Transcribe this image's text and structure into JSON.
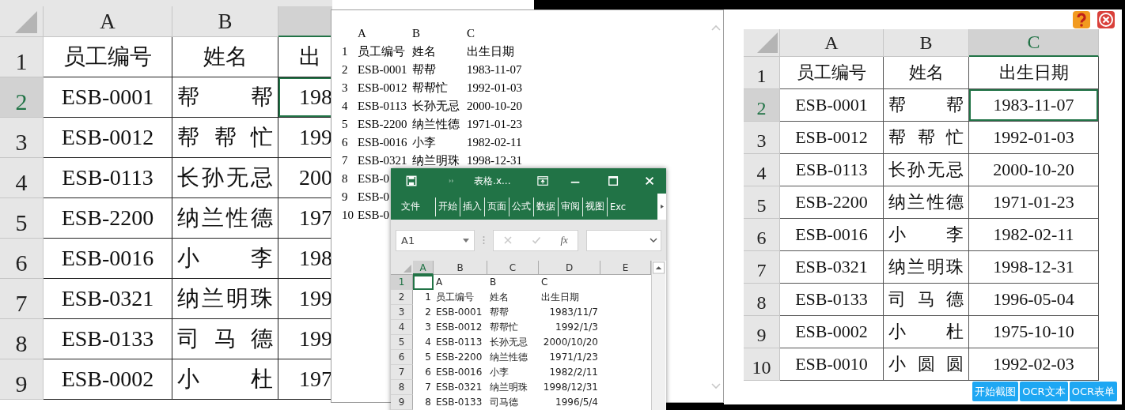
{
  "left_sheet": {
    "columns": [
      {
        "label": "A",
        "selected": false
      },
      {
        "label": "B",
        "selected": false
      },
      {
        "selected": true
      }
    ],
    "rows": [
      {
        "header": "1",
        "selected": false,
        "cells": [
          {
            "text": "员工编号",
            "selected": false
          },
          {
            "text": "姓名",
            "selected": false
          },
          {
            "text": "出",
            "selected": false
          }
        ]
      },
      {
        "header": "2",
        "selected": true,
        "cells": [
          {
            "text": "ESB-0001",
            "selected": false
          },
          {
            "text": "帮帮",
            "selected": false
          },
          {
            "text": "198",
            "selected": true
          }
        ]
      },
      {
        "header": "3",
        "selected": false,
        "cells": [
          {
            "text": "ESB-0012",
            "selected": false
          },
          {
            "text": "帮帮忙",
            "selected": false
          },
          {
            "text": "199",
            "selected": false
          }
        ]
      },
      {
        "header": "4",
        "selected": false,
        "cells": [
          {
            "text": "ESB-0113",
            "selected": false
          },
          {
            "text": "长孙无忌",
            "selected": false
          },
          {
            "text": "200",
            "selected": false
          }
        ]
      },
      {
        "header": "5",
        "selected": false,
        "cells": [
          {
            "text": "ESB-2200",
            "selected": false
          },
          {
            "text": "纳兰性德",
            "selected": false
          },
          {
            "text": "197",
            "selected": false
          }
        ]
      },
      {
        "header": "6",
        "selected": false,
        "cells": [
          {
            "text": "ESB-0016",
            "selected": false
          },
          {
            "text": "小李",
            "selected": false
          },
          {
            "text": "198",
            "selected": false
          }
        ]
      },
      {
        "header": "7",
        "selected": false,
        "cells": [
          {
            "text": "ESB-0321",
            "selected": false
          },
          {
            "text": "纳兰明珠",
            "selected": false
          },
          {
            "text": "199",
            "selected": false
          }
        ]
      },
      {
        "header": "8",
        "selected": false,
        "cells": [
          {
            "text": "ESB-0133",
            "selected": false
          },
          {
            "text": "司马德",
            "selected": false
          },
          {
            "text": "199",
            "selected": false
          }
        ]
      },
      {
        "header": "9",
        "selected": false,
        "cells": [
          {
            "text": "ESB-0002",
            "selected": false
          },
          {
            "text": "小杜",
            "selected": false
          },
          {
            "text": "197",
            "selected": false
          }
        ]
      }
    ]
  },
  "text_view": {
    "header": [
      "A",
      "B",
      "C"
    ],
    "lines": [
      {
        "number": "1",
        "fields": [
          "员工编号",
          "姓名",
          "出生日期"
        ]
      },
      {
        "number": "2",
        "fields": [
          "ESB-0001",
          "帮帮",
          "1983-11-07"
        ]
      },
      {
        "number": "3",
        "fields": [
          "ESB-0012",
          "帮帮忙",
          "1992-01-03"
        ]
      },
      {
        "number": "4",
        "fields": [
          "ESB-0113",
          "长孙无忌",
          "2000-10-20"
        ]
      },
      {
        "number": "5",
        "fields": [
          "ESB-2200",
          "纳兰性德",
          "1971-01-23"
        ]
      },
      {
        "number": "6",
        "fields": [
          "ESB-0016",
          "小李",
          "1982-02-11"
        ]
      },
      {
        "number": "7",
        "fields": [
          "ESB-0321",
          "纳兰明珠",
          "1998-12-31"
        ]
      },
      {
        "number": "8",
        "fields": [
          "ESB-0"
        ]
      },
      {
        "number": "9",
        "fields": [
          "ESB-0"
        ]
      },
      {
        "number": "10",
        "fields": [
          "ESB-0"
        ]
      }
    ]
  },
  "excel_window": {
    "title": "表格.x...",
    "tabs": [
      {
        "label": "文件",
        "selected": false
      },
      {
        "label": "开始",
        "selected": false
      },
      {
        "label": "插入",
        "selected": false
      },
      {
        "label": "页面",
        "selected": false
      },
      {
        "label": "公式",
        "selected": false
      },
      {
        "label": "数据",
        "selected": false
      },
      {
        "label": "审阅",
        "selected": false
      },
      {
        "label": "视图",
        "selected": false
      },
      {
        "label": "Exc",
        "selected": false
      }
    ],
    "name_box": "A1",
    "function_label": "fx",
    "columns": [
      {
        "label": "A",
        "selected": true
      },
      {
        "label": "B",
        "selected": false
      },
      {
        "label": "C",
        "selected": false
      },
      {
        "label": "D",
        "selected": false
      },
      {
        "label": "E",
        "selected": false
      }
    ],
    "rows": [
      {
        "header": "1",
        "selected": true,
        "cells": [
          {
            "selected": true
          },
          {
            "text": "A",
            "kind": "text",
            "selected": false
          },
          {
            "text": "B",
            "kind": "text",
            "selected": false
          },
          {
            "text": "C",
            "kind": "text",
            "selected": false
          }
        ]
      },
      {
        "header": "2",
        "selected": false,
        "cells": [
          {
            "text": "1",
            "kind": "number",
            "selected": false
          },
          {
            "text": "员工编号",
            "kind": "text",
            "selected": false
          },
          {
            "text": "姓名",
            "kind": "text",
            "selected": false
          },
          {
            "text": "出生日期",
            "kind": "text",
            "selected": false
          }
        ]
      },
      {
        "header": "3",
        "selected": false,
        "cells": [
          {
            "text": "2",
            "kind": "number",
            "selected": false
          },
          {
            "text": "ESB-0001",
            "kind": "text",
            "selected": false
          },
          {
            "text": "帮帮",
            "kind": "text",
            "selected": false
          },
          {
            "text": "1983/11/7",
            "kind": "number",
            "selected": false
          }
        ]
      },
      {
        "header": "4",
        "selected": false,
        "cells": [
          {
            "text": "3",
            "kind": "number",
            "selected": false
          },
          {
            "text": "ESB-0012",
            "kind": "text",
            "selected": false
          },
          {
            "text": "帮帮忙",
            "kind": "text",
            "selected": false
          },
          {
            "text": "1992/1/3",
            "kind": "number",
            "selected": false
          }
        ]
      },
      {
        "header": "5",
        "selected": false,
        "cells": [
          {
            "text": "4",
            "kind": "number",
            "selected": false
          },
          {
            "text": "ESB-0113",
            "kind": "text",
            "selected": false
          },
          {
            "text": "长孙无忌",
            "kind": "text",
            "selected": false
          },
          {
            "text": "2000/10/20",
            "kind": "number",
            "selected": false
          }
        ]
      },
      {
        "header": "6",
        "selected": false,
        "cells": [
          {
            "text": "5",
            "kind": "number",
            "selected": false
          },
          {
            "text": "ESB-2200",
            "kind": "text",
            "selected": false
          },
          {
            "text": "纳兰性德",
            "kind": "text",
            "selected": false
          },
          {
            "text": "1971/1/23",
            "kind": "number",
            "selected": false
          }
        ]
      },
      {
        "header": "7",
        "selected": false,
        "cells": [
          {
            "text": "6",
            "kind": "number",
            "selected": false
          },
          {
            "text": "ESB-0016",
            "kind": "text",
            "selected": false
          },
          {
            "text": "小李",
            "kind": "text",
            "selected": false
          },
          {
            "text": "1982/2/11",
            "kind": "number",
            "selected": false
          }
        ]
      },
      {
        "header": "8",
        "selected": false,
        "cells": [
          {
            "text": "7",
            "kind": "number",
            "selected": false
          },
          {
            "text": "ESB-0321",
            "kind": "text",
            "selected": false
          },
          {
            "text": "纳兰明珠",
            "kind": "text",
            "selected": false
          },
          {
            "text": "1998/12/31",
            "kind": "number",
            "selected": false
          }
        ]
      },
      {
        "header": "9",
        "selected": false,
        "cells": [
          {
            "text": "8",
            "kind": "number",
            "selected": false
          },
          {
            "text": "ESB-0133",
            "kind": "text",
            "selected": false
          },
          {
            "text": "司马德",
            "kind": "text",
            "selected": false
          },
          {
            "text": "1996/5/4",
            "kind": "number",
            "selected": false
          }
        ]
      }
    ]
  },
  "ocr_panel": {
    "sheet": {
      "columns": [
        {
          "label": "A",
          "selected": false
        },
        {
          "label": "B",
          "selected": false
        },
        {
          "label": "C",
          "selected": true
        }
      ],
      "rows": [
        {
          "header": "1",
          "selected": false,
          "cells": [
            {
              "text": "员工编号",
              "selected": false
            },
            {
              "text": "姓名",
              "selected": false
            },
            {
              "text": "出生日期",
              "selected": false
            }
          ]
        },
        {
          "header": "2",
          "selected": true,
          "cells": [
            {
              "text": "ESB-0001",
              "selected": false
            },
            {
              "text": "帮帮",
              "selected": false
            },
            {
              "text": "1983-11-07",
              "selected": true
            }
          ]
        },
        {
          "header": "3",
          "selected": false,
          "cells": [
            {
              "text": "ESB-0012",
              "selected": false
            },
            {
              "text": "帮帮忙",
              "selected": false
            },
            {
              "text": "1992-01-03",
              "selected": false
            }
          ]
        },
        {
          "header": "4",
          "selected": false,
          "cells": [
            {
              "text": "ESB-0113",
              "selected": false
            },
            {
              "text": "长孙无忌",
              "selected": false
            },
            {
              "text": "2000-10-20",
              "selected": false
            }
          ]
        },
        {
          "header": "5",
          "selected": false,
          "cells": [
            {
              "text": "ESB-2200",
              "selected": false
            },
            {
              "text": "纳兰性德",
              "selected": false
            },
            {
              "text": "1971-01-23",
              "selected": false
            }
          ]
        },
        {
          "header": "6",
          "selected": false,
          "cells": [
            {
              "text": "ESB-0016",
              "selected": false
            },
            {
              "text": "小李",
              "selected": false
            },
            {
              "text": "1982-02-11",
              "selected": false
            }
          ]
        },
        {
          "header": "7",
          "selected": false,
          "cells": [
            {
              "text": "ESB-0321",
              "selected": false
            },
            {
              "text": "纳兰明珠",
              "selected": false
            },
            {
              "text": "1998-12-31",
              "selected": false
            }
          ]
        },
        {
          "header": "8",
          "selected": false,
          "cells": [
            {
              "text": "ESB-0133",
              "selected": false
            },
            {
              "text": "司马德",
              "selected": false
            },
            {
              "text": "1996-05-04",
              "selected": false
            }
          ]
        },
        {
          "header": "9",
          "selected": false,
          "cells": [
            {
              "text": "ESB-0002",
              "selected": false
            },
            {
              "text": "小杜",
              "selected": false
            },
            {
              "text": "1975-10-10",
              "selected": false
            }
          ]
        },
        {
          "header": "10",
          "selected": false,
          "cells": [
            {
              "text": "ESB-0010",
              "selected": false
            },
            {
              "text": "小圆圆",
              "selected": false
            },
            {
              "text": "1992-02-03",
              "selected": false
            }
          ]
        }
      ]
    },
    "buttons": [
      "开始截图",
      "OCR文本",
      "OCR表单"
    ]
  }
}
